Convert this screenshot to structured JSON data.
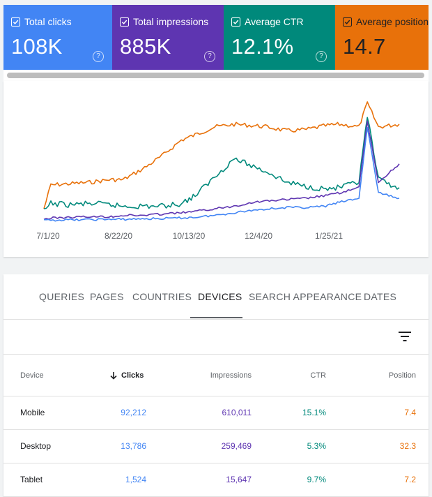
{
  "metrics": [
    {
      "label": "Total clicks",
      "value": "108K",
      "color": "#4285f4"
    },
    {
      "label": "Total impressions",
      "value": "885K",
      "color": "#5e35b1"
    },
    {
      "label": "Average CTR",
      "value": "12.1%",
      "color": "#00897b"
    },
    {
      "label": "Average position",
      "value": "14.7",
      "color": "#e8710a"
    }
  ],
  "help_glyph": "?",
  "chart_data": {
    "type": "line",
    "x_tick_labels": [
      "7/1/20",
      "8/22/20",
      "10/13/20",
      "12/4/20",
      "1/25/21"
    ],
    "x_range": [
      "2020-06-26",
      "2021-03-09"
    ],
    "y_axis_visible": false,
    "grid": false,
    "series": [
      {
        "color": "#e8710a",
        "x": [
          "2020-06-26",
          "2020-07-01",
          "2020-07-15",
          "2020-07-29",
          "2020-08-12",
          "2020-08-22",
          "2020-09-05",
          "2020-09-19",
          "2020-10-03",
          "2020-10-13",
          "2020-10-27",
          "2020-11-10",
          "2020-11-24",
          "2020-12-04",
          "2020-12-18",
          "2021-01-01",
          "2021-01-15",
          "2021-01-25",
          "2021-02-08",
          "2021-02-14",
          "2021-02-22",
          "2021-03-09"
        ],
        "y": [
          5,
          14,
          14.5,
          15,
          16,
          16,
          20,
          25,
          31,
          33,
          36,
          37,
          36.5,
          36,
          34.5,
          35,
          36.5,
          37,
          36,
          45,
          36,
          37
        ]
      },
      {
        "color": "#00897b",
        "x": [
          "2020-06-26",
          "2020-07-01",
          "2020-07-15",
          "2020-07-29",
          "2020-08-12",
          "2020-08-22",
          "2020-09-05",
          "2020-09-19",
          "2020-10-03",
          "2020-10-13",
          "2020-10-27",
          "2020-11-10",
          "2020-11-24",
          "2020-12-04",
          "2020-12-18",
          "2021-01-01",
          "2021-01-15",
          "2021-01-25",
          "2021-02-08",
          "2021-02-14",
          "2021-02-22",
          "2021-03-09"
        ],
        "y": [
          4,
          7,
          6.5,
          7,
          6.5,
          6,
          6,
          6,
          7,
          10,
          17,
          24,
          21,
          19,
          15,
          13.5,
          12.5,
          13,
          15,
          40,
          16,
          13
        ]
      },
      {
        "color": "#5e35b1",
        "x": [
          "2020-06-26",
          "2020-07-01",
          "2020-07-15",
          "2020-07-29",
          "2020-08-12",
          "2020-08-22",
          "2020-09-05",
          "2020-09-19",
          "2020-10-03",
          "2020-10-13",
          "2020-10-27",
          "2020-11-10",
          "2020-11-24",
          "2020-12-04",
          "2020-12-18",
          "2021-01-01",
          "2021-01-15",
          "2021-01-25",
          "2021-02-08",
          "2021-02-14",
          "2021-02-22",
          "2021-03-09"
        ],
        "y": [
          1,
          1.5,
          1.8,
          2,
          2,
          2.5,
          2.5,
          3,
          3.5,
          4,
          5,
          6,
          7.5,
          8,
          8.5,
          9,
          10,
          11,
          13,
          38,
          15,
          22
        ]
      },
      {
        "color": "#4285f4",
        "x": [
          "2020-06-26",
          "2020-07-01",
          "2020-07-15",
          "2020-07-29",
          "2020-08-12",
          "2020-08-22",
          "2020-09-05",
          "2020-09-19",
          "2020-10-03",
          "2020-10-13",
          "2020-10-27",
          "2020-11-10",
          "2020-11-24",
          "2020-12-04",
          "2020-12-18",
          "2021-01-01",
          "2021-01-15",
          "2021-01-25",
          "2021-02-08",
          "2021-02-14",
          "2021-02-22",
          "2021-03-09"
        ],
        "y": [
          0.5,
          0.7,
          0.8,
          0.9,
          1,
          1,
          1.2,
          1.3,
          1.5,
          1.8,
          2.5,
          3.5,
          4.5,
          5,
          5.5,
          5.5,
          6,
          7.5,
          9,
          36,
          11,
          9
        ]
      }
    ]
  },
  "tabs": [
    "QUERIES",
    "PAGES",
    "COUNTRIES",
    "DEVICES",
    "SEARCH APPEARANCE",
    "DATES"
  ],
  "active_tab": "DEVICES",
  "table": {
    "headers": {
      "device": "Device",
      "clicks": "Clicks",
      "impressions": "Impressions",
      "ctr": "CTR",
      "position": "Position"
    },
    "sorted_by": "Clicks",
    "rows": [
      {
        "device": "Mobile",
        "clicks": "92,212",
        "impressions": "610,011",
        "ctr": "15.1%",
        "position": "7.4"
      },
      {
        "device": "Desktop",
        "clicks": "13,786",
        "impressions": "259,469",
        "ctr": "5.3%",
        "position": "32.3"
      },
      {
        "device": "Tablet",
        "clicks": "1,524",
        "impressions": "15,647",
        "ctr": "9.7%",
        "position": "7.2"
      }
    ]
  }
}
